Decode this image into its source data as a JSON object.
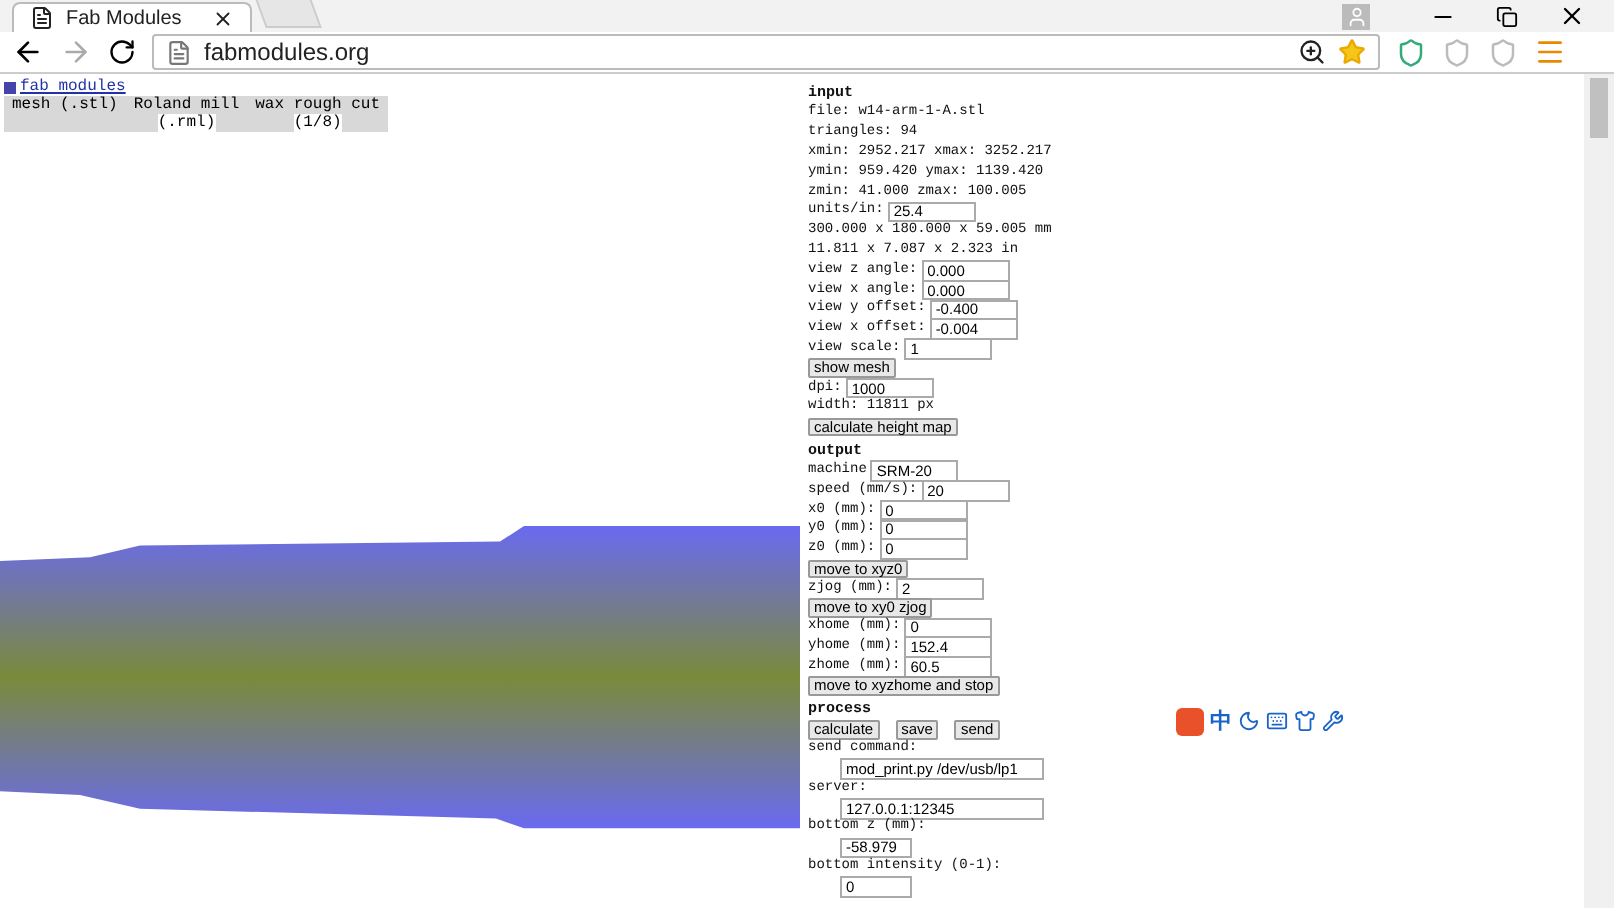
{
  "browser": {
    "tab_title": "Fab Modules",
    "url": "fabmodules.org"
  },
  "header": {
    "link": "fab modules",
    "menu": [
      {
        "line1": "mesh (.stl)"
      },
      {
        "line1": "Roland mill",
        "line2": "(.rml)"
      },
      {
        "line1": "wax rough cut",
        "line2": "(1/8)"
      }
    ]
  },
  "sections": [
    {
      "title": "input",
      "items": [
        {
          "kind": "text",
          "text": "file: w14-arm-1-A.stl"
        },
        {
          "kind": "text",
          "text": "triangles: 94"
        },
        {
          "kind": "text",
          "text": "xmin: 2952.217 xmax: 3252.217"
        },
        {
          "kind": "text",
          "text": "ymin: 959.420 ymax: 1139.420"
        },
        {
          "kind": "text",
          "text": "zmin: 41.000 zmax: 100.005"
        },
        {
          "kind": "field",
          "label": "units/in:",
          "value": "25.4"
        },
        {
          "kind": "text",
          "text": "300.000 x 180.000 x 59.005 mm"
        },
        {
          "kind": "text",
          "text": "11.811 x 7.087 x 2.323 in"
        },
        {
          "kind": "field",
          "label": "view z angle:",
          "value": "0.000"
        },
        {
          "kind": "field",
          "label": "view x angle:",
          "value": "0.000"
        },
        {
          "kind": "field",
          "label": "view y offset:",
          "value": "-0.400"
        },
        {
          "kind": "field",
          "label": "view x offset:",
          "value": "-0.004"
        },
        {
          "kind": "field",
          "label": "view scale:",
          "value": "1"
        },
        {
          "kind": "buttons",
          "labels": [
            "show mesh"
          ]
        },
        {
          "kind": "field",
          "label": "dpi:",
          "value": "1000"
        },
        {
          "kind": "text",
          "text": "width: 11811 px"
        },
        {
          "kind": "buttons",
          "labels": [
            "calculate height map"
          ]
        }
      ]
    },
    {
      "title": "output",
      "items": [
        {
          "kind": "field",
          "label": "machine",
          "value": "SRM-20"
        },
        {
          "kind": "field",
          "label": "speed (mm/s):",
          "value": "20"
        },
        {
          "kind": "field",
          "label": "x0 (mm):",
          "value": "0"
        },
        {
          "kind": "field",
          "label": "y0 (mm):",
          "value": "0"
        },
        {
          "kind": "field",
          "label": "z0 (mm):",
          "value": "0"
        },
        {
          "kind": "buttons",
          "labels": [
            "move to xyz0"
          ]
        },
        {
          "kind": "field",
          "label": "zjog (mm):",
          "value": "2"
        },
        {
          "kind": "buttons",
          "labels": [
            "move to xy0 zjog"
          ]
        },
        {
          "kind": "field",
          "label": "xhome (mm):",
          "value": "0"
        },
        {
          "kind": "field",
          "label": "yhome (mm):",
          "value": "152.4"
        },
        {
          "kind": "field",
          "label": "zhome (mm):",
          "value": "60.5"
        },
        {
          "kind": "buttons",
          "labels": [
            "move to xyzhome and stop"
          ]
        }
      ]
    },
    {
      "title": "process",
      "items": [
        {
          "kind": "buttons",
          "labels": [
            "calculate",
            "save",
            "send"
          ]
        },
        {
          "kind": "text",
          "text": "send command:"
        },
        {
          "kind": "input",
          "value": "mod_print.py /dev/usb/lp1"
        },
        {
          "kind": "text",
          "text": "server:"
        },
        {
          "kind": "input",
          "value": "127.0.0.1:12345"
        },
        {
          "kind": "text",
          "text": "bottom z (mm):"
        },
        {
          "kind": "input",
          "value": "-58.979"
        },
        {
          "kind": "text",
          "text": "bottom intensity (0-1):"
        },
        {
          "kind": "input",
          "value": "0"
        }
      ]
    }
  ],
  "ime_toolbar": {
    "mode_label": "中"
  }
}
